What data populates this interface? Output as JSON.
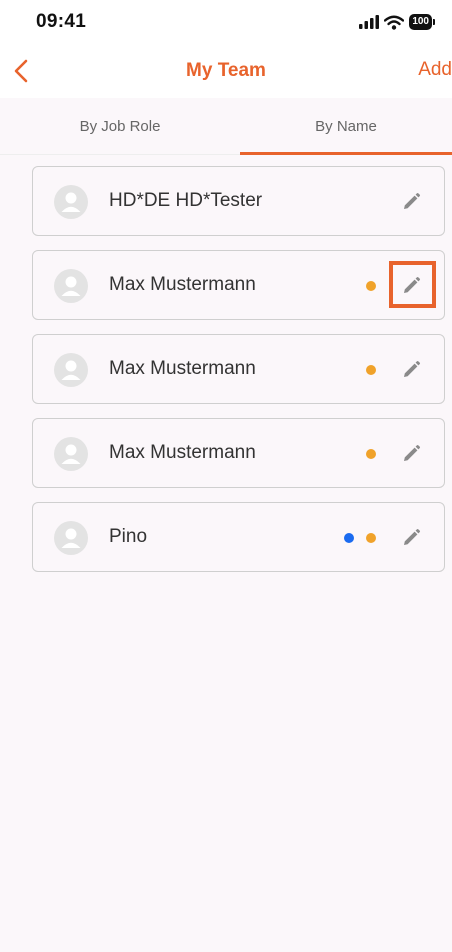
{
  "status_bar": {
    "time": "09:41",
    "battery": "100"
  },
  "nav": {
    "title": "My Team",
    "add_label": "Add"
  },
  "tabs": [
    {
      "label": "By Job Role",
      "selected": false
    },
    {
      "label": "By Name",
      "selected": true
    }
  ],
  "members": [
    {
      "name": "HD*DE HD*Tester",
      "orange_dot": false,
      "blue_dot": false
    },
    {
      "name": "Max Mustermann",
      "orange_dot": true,
      "blue_dot": false,
      "edit_highlighted": true
    },
    {
      "name": "Max Mustermann",
      "orange_dot": true,
      "blue_dot": false
    },
    {
      "name": "Max Mustermann",
      "orange_dot": true,
      "blue_dot": false
    },
    {
      "name": "Pino",
      "orange_dot": true,
      "blue_dot": true
    }
  ],
  "colors": {
    "accent": "#e8632c",
    "status_orange": "#f0a22a",
    "status_blue": "#1a6bf0"
  }
}
